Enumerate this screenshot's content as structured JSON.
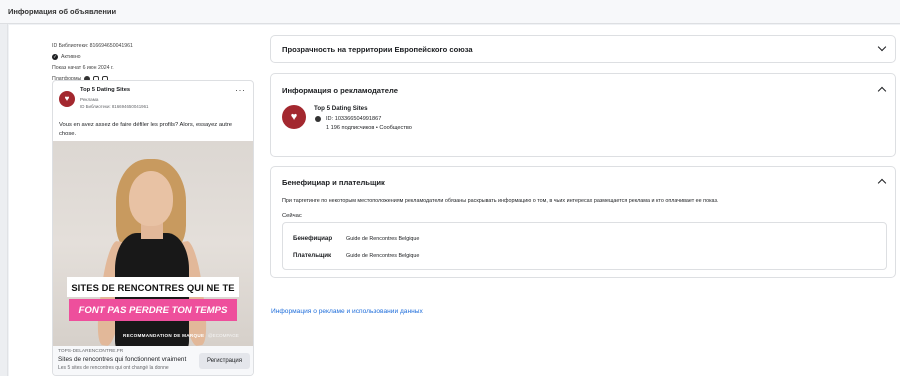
{
  "header": {
    "title": "Информация об объявлении"
  },
  "meta": {
    "library_id": "ID Библиотеки: 816694650041961",
    "status": "Активно",
    "started": "Показ начат 6 июн 2024 г.",
    "platforms_label": "Платформы"
  },
  "ad": {
    "page_name": "Top 5 Dating Sites",
    "sponsored": "Реклама",
    "library_id": "ID Библиотеки: 816694650041961",
    "more": "···",
    "primary_text": "Vous en avez assez de faire défiler les profils? Alors, essayez autre chose.",
    "banner_line1": "SITES DE RENCONTRES QUI NE TE",
    "banner_line2": "FONT PAS PERDRE TON TEMPS",
    "watermark": "RECOMMANDATION DE MARQUE",
    "watermark2": "@ECOMPAGE",
    "domain": "TOPS-DELARENCONTRE.FR",
    "headline": "Sites de rencontres qui fonctionnent vraiment",
    "description": "Les 5 sites de rencontres qui ont changé la donne",
    "cta": "Регистрация"
  },
  "panels": {
    "eu": {
      "title": "Прозрачность на территории Европейского союза"
    },
    "advertiser": {
      "title": "Информация о рекламодателе",
      "name": "Top 5 Dating Sites",
      "id": "ID: 103366504991867",
      "subscribers": "1 196 подписчиков • Сообщество"
    },
    "beneficiary": {
      "title": "Бенефициар и плательщик",
      "note": "При таргетинге по некоторым местоположениям рекламодатели обязаны раскрывать информацию о том, в чьих интересах размещается реклама и кто оплачивает ее показ.",
      "now_label": "Сейчас",
      "beneficiary_label": "Бенефициар",
      "beneficiary_value": "Guide de Rencontres Belgique",
      "payer_label": "Плательщик",
      "payer_value": "Guide de Rencontres Belgique"
    }
  },
  "footer_link": "Информация о рекламе и использовании данных",
  "colors": {
    "brand_red": "#a3282f",
    "pink_banner": "#ee4f9c",
    "link_blue": "#216fdb"
  },
  "icons": [
    "check-icon",
    "facebook-icon",
    "instagram-icon",
    "messenger-icon",
    "heart-logo-icon",
    "chevron-down-icon",
    "chevron-up-icon"
  ]
}
